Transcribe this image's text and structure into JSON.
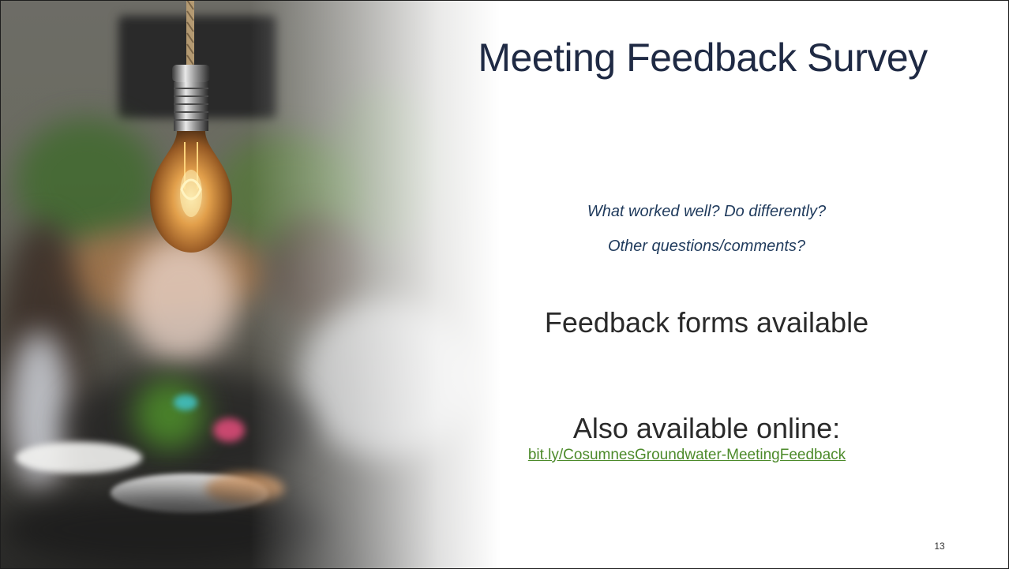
{
  "slide": {
    "title": "Meeting Feedback Survey",
    "questions": [
      "What worked well? Do differently?",
      "Other questions/comments?"
    ],
    "forms_text": "Feedback forms available",
    "online_text": "Also available online:",
    "link_text": "bit.ly/CosumnesGroundwater-MeetingFeedback",
    "page_number": "13"
  },
  "colors": {
    "title": "#1f2a44",
    "questions": "#1f3a5c",
    "link": "#4c8a2a",
    "body_text": "#2a2a2a"
  }
}
